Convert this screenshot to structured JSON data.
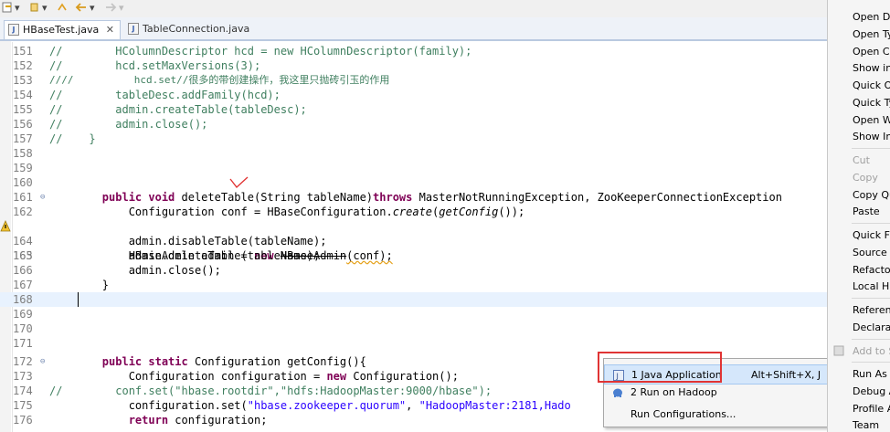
{
  "toolbar": {
    "icons": [
      "new-wizard-icon",
      "dropdown-arrow-icon",
      "back-icon",
      "forward-icon"
    ]
  },
  "tabs": [
    {
      "label": "HBaseTest.java",
      "active": true,
      "close": "✕"
    },
    {
      "label": "TableConnection.java",
      "active": false
    }
  ],
  "editor": {
    "lines": [
      {
        "num": "151",
        "prefix": "//",
        "text": "        HColumnDescriptor hcd = new HColumnDescriptor(family);"
      },
      {
        "num": "152",
        "prefix": "//",
        "text": "        hcd.setMaxVersions(3);"
      },
      {
        "num": "153",
        "prefix": "////",
        "text": "          hcd.set//很多的带创建操作，我这里只抛砖引玉的作用"
      },
      {
        "num": "154",
        "prefix": "//",
        "text": "        tableDesc.addFamily(hcd);"
      },
      {
        "num": "155",
        "prefix": "//",
        "text": "        admin.createTable(tableDesc);"
      },
      {
        "num": "156",
        "prefix": "//",
        "text": "        admin.close();"
      },
      {
        "num": "157",
        "prefix": "//",
        "text": "    }"
      },
      {
        "num": "158"
      },
      {
        "num": "159"
      },
      {
        "num": "160"
      },
      {
        "num": "161",
        "kw": "public void ",
        "text": "deleteTable(String tableName)",
        "kw2": "throws",
        "text2": " MasterNotRunningException, ZooKeeperConnectionException"
      },
      {
        "num": "162",
        "text": "Configuration conf = HBaseConfiguration.",
        "it": "create",
        "text2": "(",
        "it2": "getConfig",
        "text3": "());"
      },
      {
        "num": "163",
        "text": "HBaseAdmin admin = ",
        "kw": "new ",
        "strike": "HBaseAdmin",
        "text2": "(conf);"
      },
      {
        "num": "164",
        "text": "admin.disableTable(tableName);"
      },
      {
        "num": "165",
        "text": "admin.deleteTable(tableName);"
      },
      {
        "num": "166",
        "text": "admin.close();"
      },
      {
        "num": "167",
        "text": "}"
      },
      {
        "num": "168"
      },
      {
        "num": "169"
      },
      {
        "num": "170"
      },
      {
        "num": "171"
      },
      {
        "num": "172",
        "kw": "public static ",
        "text": "Configuration getConfig(){"
      },
      {
        "num": "173",
        "text": "Configuration configuration = ",
        "kw": "new ",
        "text2": "Configuration();"
      },
      {
        "num": "174",
        "prefix": "//",
        "text": "        conf.set(\"hbase.rootdir\",\"hdfs:HadoopMaster:9000/hbase\");"
      },
      {
        "num": "175",
        "text": "configuration.set(",
        "str": "\"hbase.zookeeper.quorum\"",
        "text2": ", ",
        "str2": "\"HadoopMaster:2181,Hado"
      },
      {
        "num": "176",
        "kw": "return ",
        "text": "configuration;"
      }
    ]
  },
  "context_menu": {
    "items": [
      {
        "label": "Open De",
        "enabled": true
      },
      {
        "label": "Open Ty",
        "enabled": true
      },
      {
        "label": "Open Ca",
        "enabled": true
      },
      {
        "label": "Show in",
        "enabled": true
      },
      {
        "label": "Quick Or",
        "enabled": true
      },
      {
        "label": "Quick Ty",
        "enabled": true
      },
      {
        "label": "Open W",
        "enabled": true
      },
      {
        "label": "Show In",
        "enabled": true
      },
      {
        "label": "Cut",
        "enabled": false
      },
      {
        "label": "Copy",
        "enabled": false
      },
      {
        "label": "Copy Qu",
        "enabled": true
      },
      {
        "label": "Paste",
        "enabled": true
      },
      {
        "label": "Quick Fix",
        "enabled": true
      },
      {
        "label": "Source",
        "enabled": true
      },
      {
        "label": "Refactor",
        "enabled": true
      },
      {
        "label": "Local His",
        "enabled": true
      },
      {
        "label": "Referenc",
        "enabled": true
      },
      {
        "label": "Declarat",
        "enabled": true
      },
      {
        "label": "Add to S",
        "enabled": false
      },
      {
        "label": "Run As",
        "enabled": true
      },
      {
        "label": "Debug A",
        "enabled": true
      },
      {
        "label": "Profile A",
        "enabled": true
      },
      {
        "label": "Team",
        "enabled": true
      }
    ]
  },
  "run_as_submenu": {
    "items": [
      {
        "label": "1 Java Application",
        "shortcut": "Alt+Shift+X, J",
        "icon": "java-app-icon"
      },
      {
        "label": "2 Run on Hadoop",
        "shortcut": "",
        "icon": "hadoop-elephant-icon"
      },
      {
        "label": "Run Configurations...",
        "shortcut": ""
      }
    ]
  },
  "colors": {
    "keyword": "#7f0055",
    "comment": "#3f7f5f",
    "string": "#2a00ff",
    "highlight_box": "#e03434"
  }
}
